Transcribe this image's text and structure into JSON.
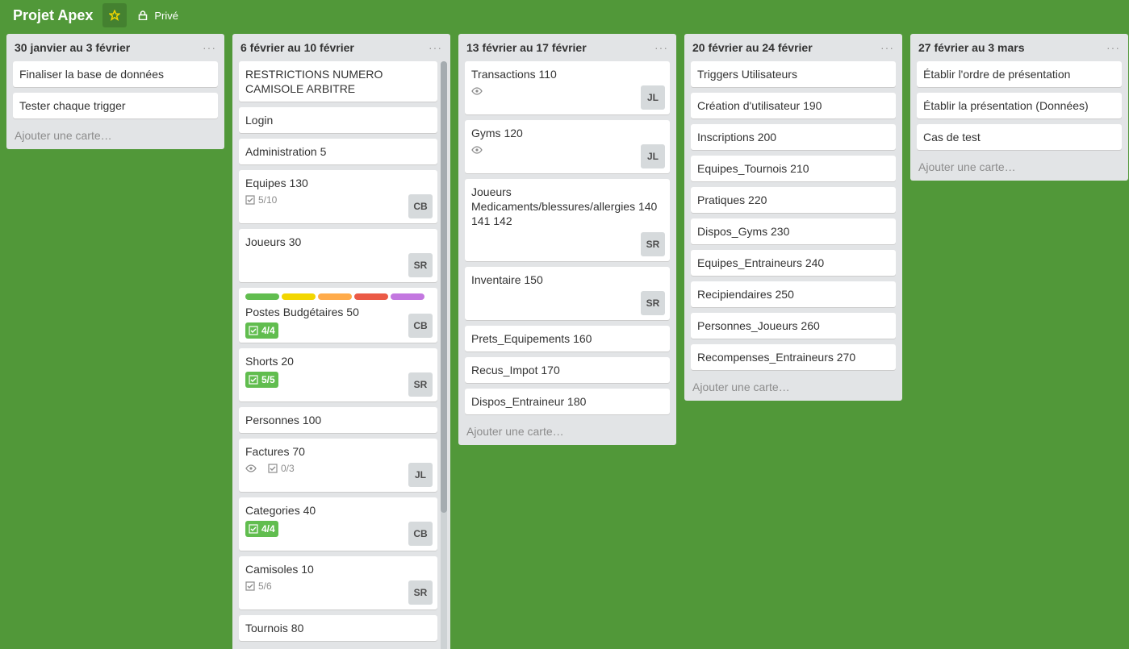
{
  "board": {
    "title": "Projet Apex",
    "privacy": "Privé"
  },
  "lists": [
    {
      "title": "30 janvier au 3 février",
      "menu": "···",
      "add": "Ajouter une carte…",
      "cards": [
        "Finaliser la base de données",
        "Tester chaque trigger"
      ]
    },
    {
      "title": "6 février au 10 février",
      "menu": "···",
      "add": "Ajouter une carte…",
      "cards": [
        {
          "title": "RESTRICTIONS NUMERO CAMISOLE ARBITRE"
        },
        {
          "title": "Login"
        },
        {
          "title": "Administration 5"
        },
        {
          "title": "Equipes 130",
          "checklist": "5/10",
          "avatar": "CB"
        },
        {
          "title": "Joueurs 30",
          "avatar": "SR"
        },
        {
          "title": "Postes Budgétaires 50",
          "checklist": "4/4",
          "avatar": "CB",
          "labels": [
            "#61bd4f",
            "#f2d600",
            "#ffab4a",
            "#eb5a46",
            "#c377e0"
          ]
        },
        {
          "title": "Shorts 20",
          "checklist": "5/5",
          "avatar": "SR"
        },
        {
          "title": "Personnes 100"
        },
        {
          "title": "Factures 70",
          "checklist": "0/3",
          "avatar": "JL"
        },
        {
          "title": "Categories 40",
          "checklist": "4/4",
          "avatar": "CB"
        },
        {
          "title": "Camisoles 10",
          "checklist": "5/6",
          "avatar": "SR"
        },
        {
          "title": "Tournois 80"
        }
      ]
    },
    {
      "title": "13 février au 17 février",
      "menu": "···",
      "add": "Ajouter une carte…",
      "cards": [
        {
          "title": "Transactions 110",
          "avatar": "JL"
        },
        {
          "title": "Gyms 120",
          "avatar": "JL"
        },
        {
          "title": "Joueurs Medicaments/blessures/allergies 140 141 142",
          "avatar": "SR"
        },
        {
          "title": "Inventaire 150",
          "avatar": "SR"
        },
        {
          "title": "Prets_Equipements 160"
        },
        {
          "title": "Recus_Impot 170"
        },
        {
          "title": "Dispos_Entraineur 180"
        }
      ]
    },
    {
      "title": "20 février au 24 février",
      "menu": "···",
      "add": "Ajouter une carte…",
      "cards": [
        "Triggers Utilisateurs",
        "Création d'utilisateur 190",
        "Inscriptions 200",
        "Equipes_Tournois 210",
        "Pratiques 220",
        "Dispos_Gyms 230",
        "Equipes_Entraineurs 240",
        "Recipiendaires 250",
        "Personnes_Joueurs 260",
        "Recompenses_Entraineurs 270"
      ]
    },
    {
      "title": "27 février au 3 mars",
      "menu": "···",
      "add": "Ajouter une carte…",
      "cards": [
        "Établir l'ordre de présentation",
        "Établir la présentation (Données)",
        "Cas de test"
      ]
    }
  ],
  "icons": {
    "star": "star-icon",
    "lock": "lock-icon",
    "eye": "eye-icon",
    "checklist": "checklist-icon"
  },
  "colors": {
    "board_bg": "#519839",
    "list_bg": "#e2e4e6",
    "badge_done": "#61bd4f",
    "star": "#f2d600"
  }
}
